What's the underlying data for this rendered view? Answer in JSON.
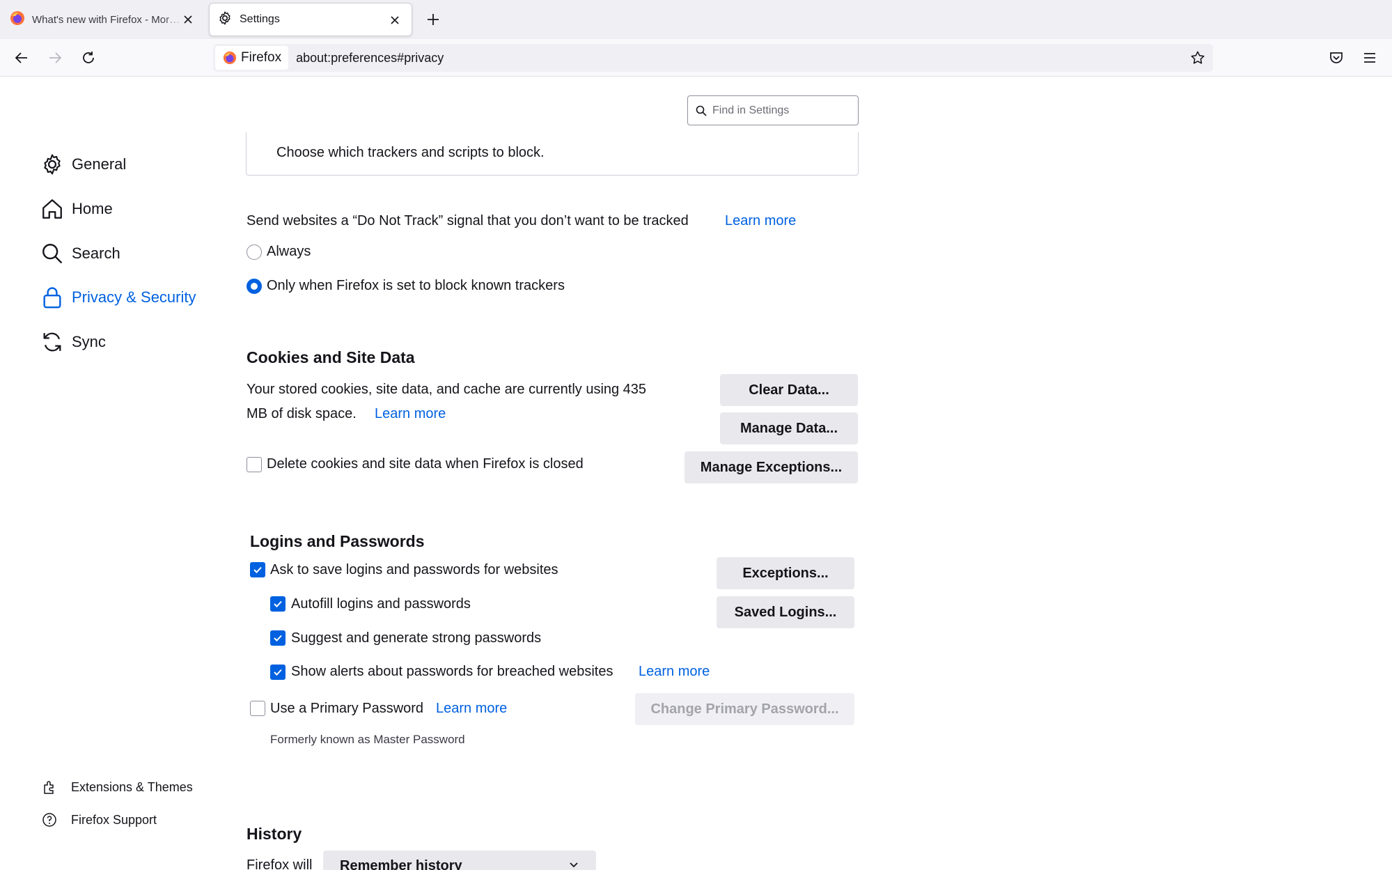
{
  "tabs": [
    {
      "title": "What's new with Firefox - More protection",
      "icon": "firefox-logo-icon",
      "active": false
    },
    {
      "title": "Settings",
      "icon": "gear-icon",
      "active": true
    }
  ],
  "navbar": {
    "identity_label": "Firefox",
    "url": "about:preferences#privacy"
  },
  "search": {
    "placeholder": "Find in Settings"
  },
  "sidebar": {
    "categories": [
      {
        "label": "General",
        "icon": "gear-icon"
      },
      {
        "label": "Home",
        "icon": "home-icon"
      },
      {
        "label": "Search",
        "icon": "search-icon"
      },
      {
        "label": "Privacy & Security",
        "icon": "lock-icon",
        "selected": true
      },
      {
        "label": "Sync",
        "icon": "sync-icon"
      }
    ],
    "footer": [
      {
        "label": "Extensions & Themes",
        "icon": "puzzle-icon"
      },
      {
        "label": "Firefox Support",
        "icon": "help-icon"
      }
    ]
  },
  "tracking": {
    "custom_description": "Choose which trackers and scripts to block."
  },
  "dnt": {
    "text": "Send websites a “Do Not Track” signal that you don’t want to be tracked",
    "learn_more": "Learn more",
    "option_always": "Always",
    "option_only": "Only when Firefox is set to block known trackers",
    "selected": "only"
  },
  "cookies": {
    "heading": "Cookies and Site Data",
    "usage_line1": "Your stored cookies, site data, and cache are currently using 435",
    "usage_line2": "MB of disk space.",
    "learn_more": "Learn more",
    "clear_button": "Clear Data...",
    "manage_button": "Manage Data...",
    "exceptions_button": "Manage Exceptions...",
    "delete_on_close_label": "Delete cookies and site data when Firefox is closed",
    "delete_on_close_checked": false
  },
  "logins": {
    "heading": "Logins and Passwords",
    "ask_save": "Ask to save logins and passwords for websites",
    "autofill": "Autofill logins and passwords",
    "suggest": "Suggest and generate strong passwords",
    "alerts": "Show alerts about passwords for breached websites",
    "alerts_learn_more": "Learn more",
    "exceptions_button": "Exceptions...",
    "saved_button": "Saved Logins...",
    "primary_password": "Use a Primary Password",
    "primary_learn_more": "Learn more",
    "change_primary_button": "Change Primary Password...",
    "formerly": "Formerly known as Master Password"
  },
  "history": {
    "heading": "History",
    "firefox_will": "Firefox will",
    "mode": "Remember history"
  },
  "colors": {
    "accent": "#0061e0",
    "button_bg": "#e9e9ed",
    "tabstrip_bg": "#f0f0f4"
  }
}
